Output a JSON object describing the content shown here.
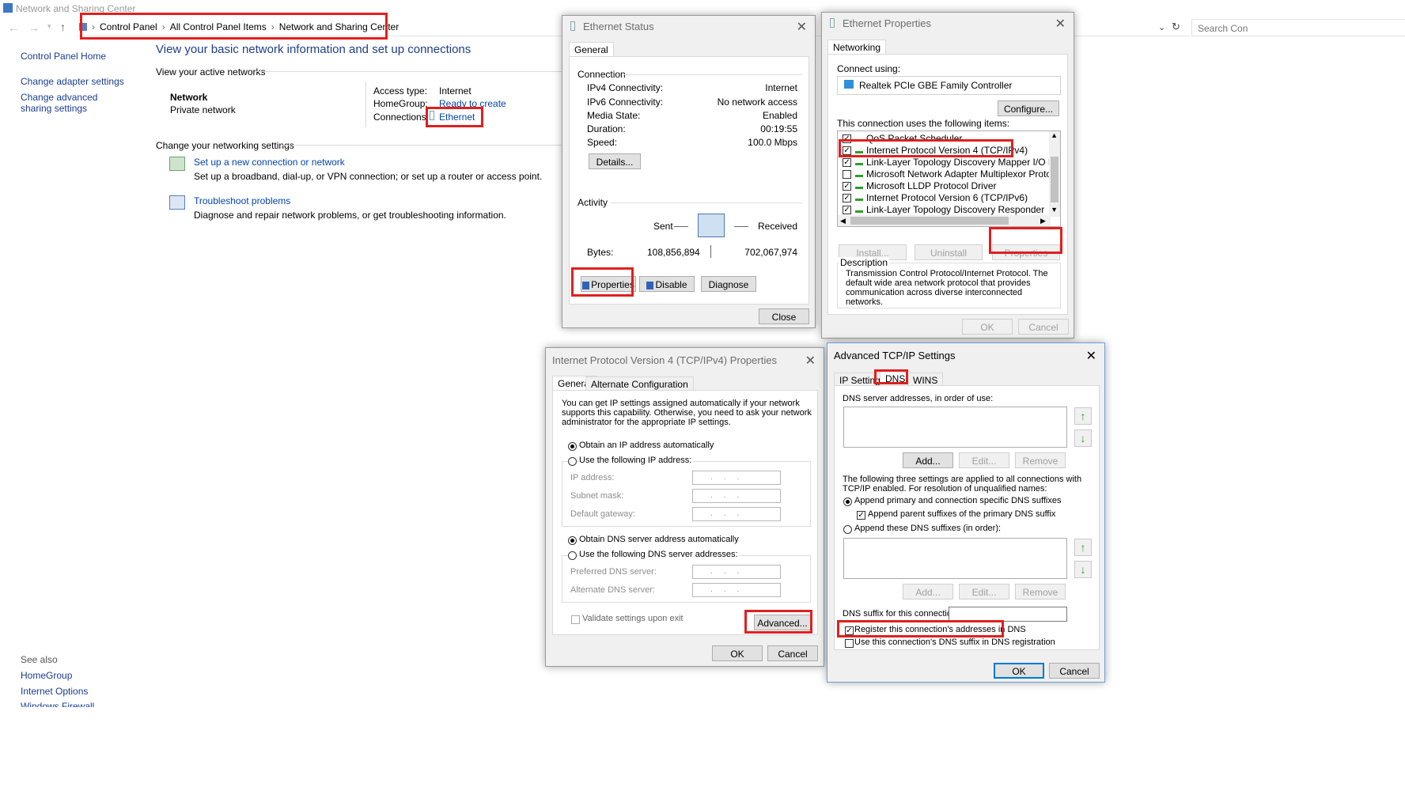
{
  "window": {
    "title": "Network and Sharing Center"
  },
  "addressbar": {
    "crumbs": [
      "Control Panel",
      "All Control Panel Items",
      "Network and Sharing Center"
    ],
    "search_placeholder": "Search Con"
  },
  "sidebar": {
    "home": "Control Panel Home",
    "items": [
      "Change adapter settings",
      "Change advanced sharing settings"
    ],
    "see_also_heading": "See also",
    "see_also": [
      "HomeGroup",
      "Internet Options",
      "Windows Firewall"
    ]
  },
  "main": {
    "title": "View your basic network information and set up connections",
    "active_heading": "View your active networks",
    "network_name": "Network",
    "network_type": "Private network",
    "access_type_label": "Access type:",
    "access_type_value": "Internet",
    "homegroup_label": "HomeGroup:",
    "homegroup_value": "Ready to create",
    "connections_label": "Connections:",
    "connections_value": "Ethernet",
    "change_heading": "Change your networking settings",
    "setup_link": "Set up a new connection or network",
    "setup_desc": "Set up a broadband, dial-up, or VPN connection; or set up a router or access point.",
    "trouble_link": "Troubleshoot problems",
    "trouble_desc": "Diagnose and repair network problems, or get troubleshooting information."
  },
  "eth_status": {
    "title": "Ethernet Status",
    "tab": "General",
    "connection_heading": "Connection",
    "rows": [
      {
        "label": "IPv4 Connectivity:",
        "value": "Internet"
      },
      {
        "label": "IPv6 Connectivity:",
        "value": "No network access"
      },
      {
        "label": "Media State:",
        "value": "Enabled"
      },
      {
        "label": "Duration:",
        "value": "00:19:55"
      },
      {
        "label": "Speed:",
        "value": "100.0 Mbps"
      }
    ],
    "details_btn": "Details...",
    "activity_heading": "Activity",
    "sent_label": "Sent",
    "received_label": "Received",
    "bytes_label": "Bytes:",
    "bytes_sent": "108,856,894",
    "bytes_received": "702,067,974",
    "properties_btn": "Properties",
    "disable_btn": "Disable",
    "diagnose_btn": "Diagnose",
    "close_btn": "Close"
  },
  "eth_props": {
    "title": "Ethernet Properties",
    "tab": "Networking",
    "connect_using": "Connect using:",
    "adapter": "Realtek PCIe GBE Family Controller",
    "configure_btn": "Configure...",
    "items_heading": "This connection uses the following items:",
    "items": [
      {
        "label": "QoS Packet Scheduler",
        "checked": true
      },
      {
        "label": "Internet Protocol Version 4 (TCP/IPv4)",
        "checked": true
      },
      {
        "label": "Link-Layer Topology Discovery Mapper I/O Driver",
        "checked": true
      },
      {
        "label": "Microsoft Network Adapter Multiplexor Protocol",
        "checked": false
      },
      {
        "label": "Microsoft LLDP Protocol Driver",
        "checked": true
      },
      {
        "label": "Internet Protocol Version 6 (TCP/IPv6)",
        "checked": true
      },
      {
        "label": "Link-Layer Topology Discovery Responder",
        "checked": true
      }
    ],
    "install_btn": "Install...",
    "uninstall_btn": "Uninstall",
    "properties_btn": "Properties",
    "description_heading": "Description",
    "description": "Transmission Control Protocol/Internet Protocol. The default wide area network protocol that provides communication across diverse interconnected networks.",
    "ok_btn": "OK",
    "cancel_btn": "Cancel"
  },
  "ipv4": {
    "title": "Internet Protocol Version 4 (TCP/IPv4) Properties",
    "tabs": [
      "General",
      "Alternate Configuration"
    ],
    "intro": "You can get IP settings assigned automatically if your network supports this capability. Otherwise, you need to ask your network administrator for the appropriate IP settings.",
    "obtain_ip": "Obtain an IP address automatically",
    "use_ip": "Use the following IP address:",
    "ip_label": "IP address:",
    "subnet_label": "Subnet mask:",
    "gateway_label": "Default gateway:",
    "obtain_dns": "Obtain DNS server address automatically",
    "use_dns": "Use the following DNS server addresses:",
    "pref_dns": "Preferred DNS server:",
    "alt_dns": "Alternate DNS server:",
    "validate": "Validate settings upon exit",
    "advanced_btn": "Advanced...",
    "ok_btn": "OK",
    "cancel_btn": "Cancel"
  },
  "adv": {
    "title": "Advanced TCP/IP Settings",
    "tabs": [
      "IP Settings",
      "DNS",
      "WINS"
    ],
    "dns_list_label": "DNS server addresses, in order of use:",
    "add_btn": "Add...",
    "edit_btn": "Edit...",
    "remove_btn": "Remove",
    "three_settings": "The following three settings are applied to all connections with TCP/IP enabled. For resolution of unqualified names:",
    "append_primary": "Append primary and connection specific DNS suffixes",
    "append_parent": "Append parent suffixes of the primary DNS suffix",
    "append_these": "Append these DNS suffixes (in order):",
    "suffix_label": "DNS suffix for this connection:",
    "register": "Register this connection's addresses in DNS",
    "use_suffix": "Use this connection's DNS suffix in DNS registration",
    "ok_btn": "OK",
    "cancel_btn": "Cancel"
  },
  "colors": {
    "highlight": "#e0201f",
    "link": "#0645ad"
  }
}
